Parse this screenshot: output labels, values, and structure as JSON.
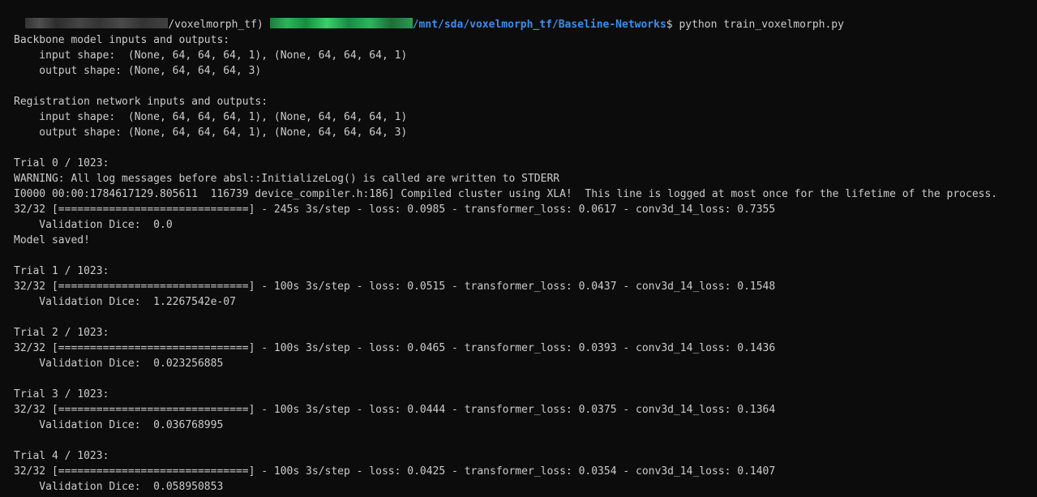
{
  "prompt": {
    "cwd_tail": "/voxelmorph_tf)",
    "path": "/mnt/sda/voxelmorph_tf/Baseline-Networks",
    "symbol": "$ ",
    "command": "python train_voxelmorph.py"
  },
  "output_lines": [
    "",
    "Backbone model inputs and outputs:",
    "    input shape:  (None, 64, 64, 64, 1), (None, 64, 64, 64, 1)",
    "    output shape: (None, 64, 64, 64, 3)",
    "",
    "Registration network inputs and outputs:",
    "    input shape:  (None, 64, 64, 64, 1), (None, 64, 64, 64, 1)",
    "    output shape: (None, 64, 64, 64, 1), (None, 64, 64, 64, 3)",
    "",
    "Trial 0 / 1023:",
    "WARNING: All log messages before absl::InitializeLog() is called are written to STDERR",
    "I0000 00:00:1784617129.805611  116739 device_compiler.h:186] Compiled cluster using XLA!  This line is logged at most once for the lifetime of the process.",
    "32/32 [==============================] - 245s 3s/step - loss: 0.0985 - transformer_loss: 0.0617 - conv3d_14_loss: 0.7355",
    "    Validation Dice:  0.0",
    "Model saved!",
    "",
    "Trial 1 / 1023:",
    "32/32 [==============================] - 100s 3s/step - loss: 0.0515 - transformer_loss: 0.0437 - conv3d_14_loss: 0.1548",
    "    Validation Dice:  1.2267542e-07",
    "",
    "Trial 2 / 1023:",
    "32/32 [==============================] - 100s 3s/step - loss: 0.0465 - transformer_loss: 0.0393 - conv3d_14_loss: 0.1436",
    "    Validation Dice:  0.023256885",
    "",
    "Trial 3 / 1023:",
    "32/32 [==============================] - 100s 3s/step - loss: 0.0444 - transformer_loss: 0.0375 - conv3d_14_loss: 0.1364",
    "    Validation Dice:  0.036768995",
    "",
    "Trial 4 / 1023:",
    "32/32 [==============================] - 100s 3s/step - loss: 0.0425 - transformer_loss: 0.0354 - conv3d_14_loss: 0.1407",
    "    Validation Dice:  0.058950853"
  ],
  "colors": {
    "background": "#0c0c0c",
    "text": "#cccccc",
    "path": "#3b8eea",
    "host": "#2fb35a"
  }
}
